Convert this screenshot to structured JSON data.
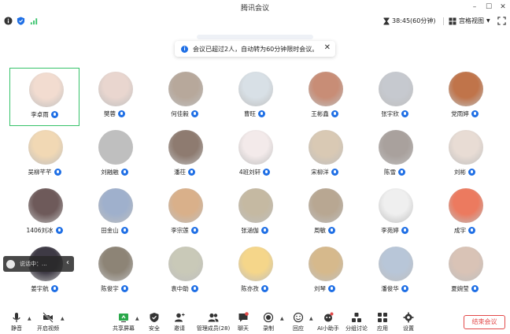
{
  "window": {
    "title": "腾讯会议",
    "controls": [
      "minimize-icon",
      "maximize-icon",
      "close-icon"
    ]
  },
  "status": {
    "timer": "38:45(60分钟)",
    "view_label": "宫格视图"
  },
  "notice": {
    "text": "会议已超过2人，自动转为60分钟限时会议。"
  },
  "participants": [
    {
      "name": "李卓雨",
      "speaking": true,
      "avatar_color": "#f2dcd0"
    },
    {
      "name": "樊蓉",
      "speaking": false,
      "avatar_color": "#e9d6cf"
    },
    {
      "name": "何佳毅",
      "speaking": false,
      "avatar_color": "#b7a89b"
    },
    {
      "name": "曹旺",
      "speaking": false,
      "avatar_color": "#d8e0e6"
    },
    {
      "name": "王彬鑫",
      "speaking": false,
      "avatar_color": "#c88d76"
    },
    {
      "name": "张宇欣",
      "speaking": false,
      "avatar_color": "#c6c9cf"
    },
    {
      "name": "党雨婷",
      "speaking": false,
      "avatar_color": "#c0744a"
    },
    {
      "name": "吴柳芊芊",
      "speaking": false,
      "avatar_color": "#f1d8b4"
    },
    {
      "name": "刘融融",
      "speaking": false,
      "avatar_color": "#bfbfbf"
    },
    {
      "name": "潘茌",
      "speaking": false,
      "avatar_color": "#8e7b70"
    },
    {
      "name": "4班刘轩",
      "speaking": false,
      "avatar_color": "#f3eaea"
    },
    {
      "name": "宋柳洋",
      "speaking": false,
      "avatar_color": "#d9c9b4"
    },
    {
      "name": "陈雪",
      "speaking": false,
      "avatar_color": "#a9a19d"
    },
    {
      "name": "刘彬",
      "speaking": false,
      "avatar_color": "#e8dcd4"
    },
    {
      "name": "1406刘冰",
      "speaking": false,
      "avatar_color": "#6e5a5a"
    },
    {
      "name": "田金山",
      "speaking": false,
      "avatar_color": "#9fb0cc"
    },
    {
      "name": "李宗莲",
      "speaking": false,
      "avatar_color": "#d9b08a"
    },
    {
      "name": "张涵伽",
      "speaking": false,
      "avatar_color": "#c5b9a2"
    },
    {
      "name": "周敏",
      "speaking": false,
      "avatar_color": "#b8a792"
    },
    {
      "name": "李苑婷",
      "speaking": false,
      "avatar_color": "#efefef"
    },
    {
      "name": "成宇",
      "speaking": false,
      "avatar_color": "#ec7a5f"
    },
    {
      "name": "姜宇航",
      "speaking": false,
      "avatar_color": "#3e3a45"
    },
    {
      "name": "陈俊宇",
      "speaking": false,
      "avatar_color": "#8d8476"
    },
    {
      "name": "袁中助",
      "speaking": false,
      "avatar_color": "#c9c9b8"
    },
    {
      "name": "陈亦孜",
      "speaking": false,
      "avatar_color": "#f5d68a"
    },
    {
      "name": "刘琴",
      "speaking": false,
      "avatar_color": "#d6b98c"
    },
    {
      "name": "潘俊华",
      "speaking": false,
      "avatar_color": "#b8c6d8"
    },
    {
      "name": "夏婉莹",
      "speaking": false,
      "avatar_color": "#d9c3b6"
    }
  ],
  "floater": {
    "text": "说话中：..."
  },
  "toolbar": {
    "mute": "静音",
    "video": "开启视频",
    "share": "共享屏幕",
    "security": "安全",
    "invite": "邀请",
    "members": "管理成员(28)",
    "chat": "聊天",
    "record": "录制",
    "reaction": "回应",
    "ai": "AI小助手",
    "breakout": "分组讨论",
    "apps": "应用",
    "settings": "设置",
    "end": "结束会议"
  },
  "colors": {
    "accent": "#1f6fe5",
    "speaking_border": "#36c26a",
    "end_button": "#e24a4a"
  }
}
